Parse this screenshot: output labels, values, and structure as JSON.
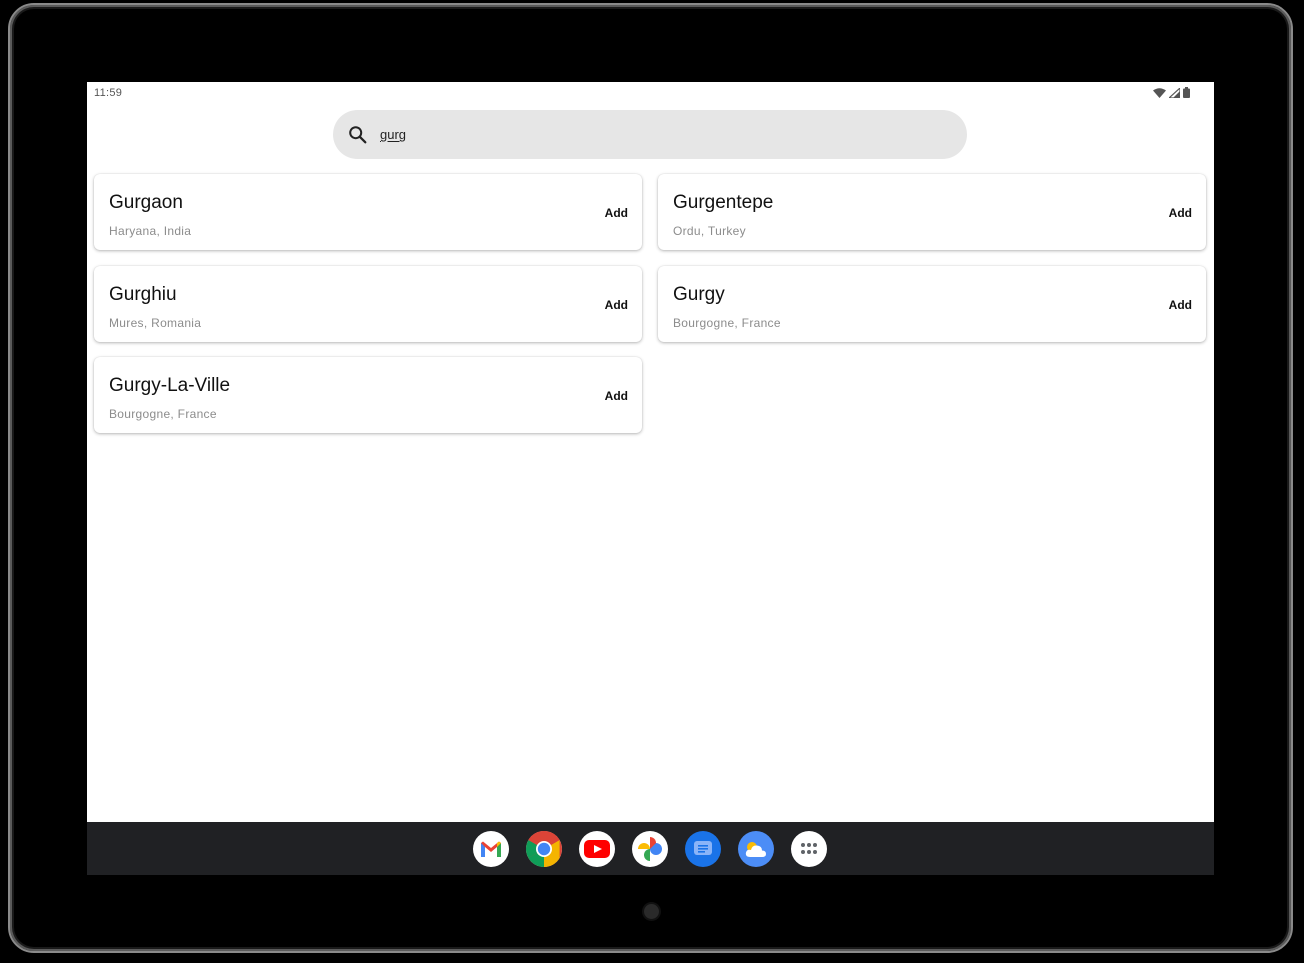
{
  "status": {
    "time": "11:59"
  },
  "search": {
    "value": "gurg"
  },
  "results": [
    {
      "city": "Gurgaon",
      "region": "Haryana, India",
      "action": "Add"
    },
    {
      "city": "Gurgentepe",
      "region": "Ordu, Turkey",
      "action": "Add"
    },
    {
      "city": "Gurghiu",
      "region": "Mures, Romania",
      "action": "Add"
    },
    {
      "city": "Gurgy",
      "region": "Bourgogne, France",
      "action": "Add"
    },
    {
      "city": "Gurgy-La-Ville",
      "region": "Bourgogne, France",
      "action": "Add"
    }
  ],
  "dock": [
    "gmail-icon",
    "chrome-icon",
    "youtube-icon",
    "photos-icon",
    "messages-icon",
    "weather-icon",
    "app-drawer-icon"
  ],
  "colors": {
    "search_bg": "#e6e6e6",
    "taskbar_bg": "#202124",
    "subtitle": "#8c8c8c"
  }
}
